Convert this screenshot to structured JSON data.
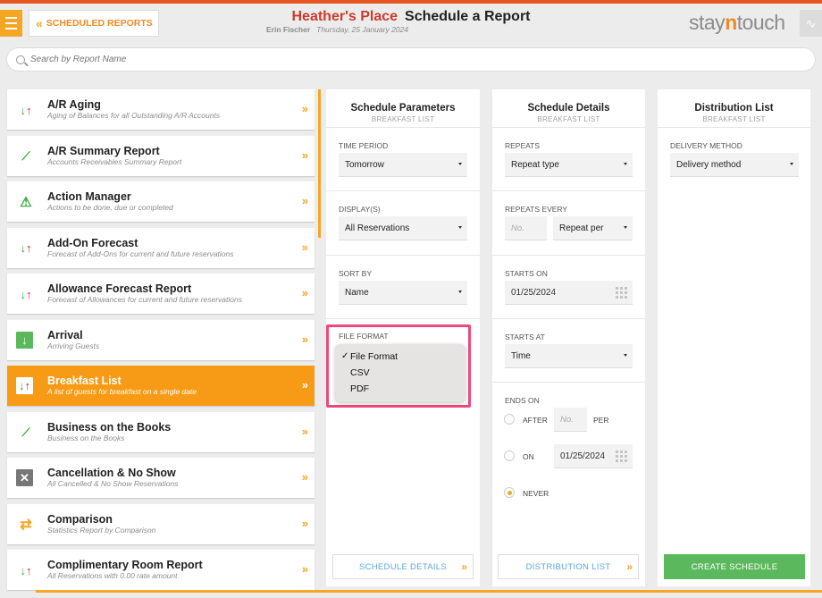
{
  "header": {
    "back_label": "SCHEDULED REPORTS",
    "hotel_name": "Heather's Place",
    "page_title": "Schedule a Report",
    "user": "Erin Fischer",
    "date": "Thursday, 25 January 2024",
    "logo_pre": "stay",
    "logo_mid": "n",
    "logo_post": "touch"
  },
  "search": {
    "placeholder": "Search by Report Name"
  },
  "reports": [
    {
      "title": "A/R Aging",
      "desc": "Aging of Balances for all Outstanding A/R Accounts",
      "icon": "up-down-arrows-icon"
    },
    {
      "title": "A/R Summary Report",
      "desc": "Accounts Receivables Summary Report",
      "icon": "trend-chart-icon"
    },
    {
      "title": "Action Manager",
      "desc": "Actions to be done, due or completed",
      "icon": "warning-triangle-icon"
    },
    {
      "title": "Add-On Forecast",
      "desc": "Forecast of Add-Ons for current and future reservations",
      "icon": "up-down-arrows-icon"
    },
    {
      "title": "Allowance Forecast Report",
      "desc": "Forecast of Allowances for current and future reservations",
      "icon": "up-down-arrows-icon"
    },
    {
      "title": "Arrival",
      "desc": "Arriving Guests",
      "icon": "arrival-down-icon"
    },
    {
      "title": "Breakfast List",
      "desc": "A list of guests for breakfast on a single date",
      "icon": "up-down-arrows-icon"
    },
    {
      "title": "Business on the Books",
      "desc": "Business on the Books",
      "icon": "trend-chart-icon"
    },
    {
      "title": "Cancellation & No Show",
      "desc": "All Cancelled & No Show Reservations",
      "icon": "cancel-x-icon"
    },
    {
      "title": "Comparison",
      "desc": "Statistics Report by Comparison",
      "icon": "swap-arrows-icon"
    },
    {
      "title": "Complimentary Room Report",
      "desc": "All Reservations with 0.00 rate amount",
      "icon": "up-down-arrows-icon"
    }
  ],
  "params": {
    "title": "Schedule Parameters",
    "subtitle": "BREAKFAST LIST",
    "time_period_label": "TIME PERIOD",
    "time_period_value": "Tomorrow",
    "displays_label": "DISPLAY(S)",
    "displays_value": "All Reservations",
    "sort_label": "SORT BY",
    "sort_value": "Name",
    "file_format_label": "FILE FORMAT",
    "file_format_options": [
      "File Format",
      "CSV",
      "PDF"
    ],
    "footer_button": "SCHEDULE DETAILS"
  },
  "details": {
    "title": "Schedule Details",
    "subtitle": "BREAKFAST LIST",
    "repeats_label": "REPEATS",
    "repeats_value": "Repeat type",
    "repeats_every_label": "REPEATS EVERY",
    "repeats_every_placeholder": "No.",
    "repeats_every_value": "Repeat per",
    "starts_on_label": "STARTS ON",
    "starts_on_value": "01/25/2024",
    "starts_at_label": "STARTS AT",
    "starts_at_value": "Time",
    "ends_on_label": "ENDS ON",
    "after_label": "AFTER",
    "after_placeholder": "No.",
    "per_label": "PER",
    "on_label": "ON",
    "on_value": "01/25/2024",
    "never_label": "NEVER",
    "footer_button": "DISTRIBUTION LIST"
  },
  "distribution": {
    "title": "Distribution List",
    "subtitle": "BREAKFAST LIST",
    "delivery_label": "DELIVERY METHOD",
    "delivery_value": "Delivery method",
    "footer_button": "CREATE SCHEDULE"
  },
  "colors": {
    "accent": "#f5a623",
    "active": "#f79a16",
    "brand_red": "#cc3b2b",
    "link_blue": "#5aa9d8",
    "green": "#5cb85c",
    "highlight": "#f0487a"
  }
}
